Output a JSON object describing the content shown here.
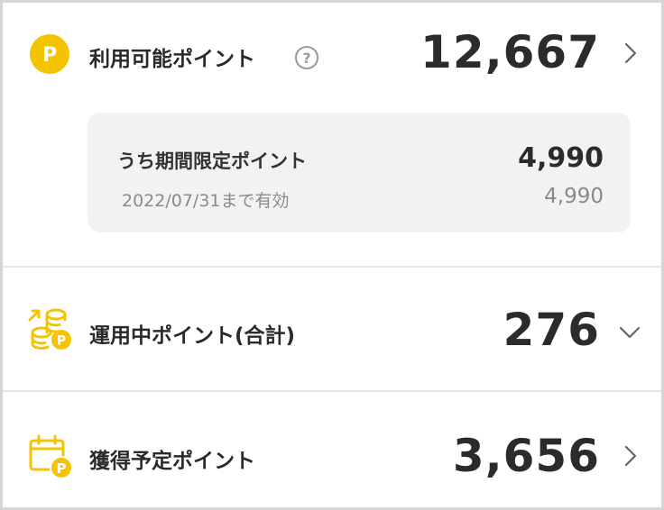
{
  "available": {
    "label": "利用可能ポイント",
    "value": "12,667",
    "icon": "p-coin-icon",
    "help_icon": "question-circle-icon",
    "chevron_icon": "chevron-right-icon"
  },
  "limited": {
    "label": "うち期間限定ポイント",
    "value": "4,990",
    "expiry_text": "2022/07/31まで有効",
    "expiry_value": "4,990"
  },
  "invested": {
    "label": "運用中ポイント(合計)",
    "value": "276",
    "icon": "coin-stack-icon",
    "chevron_icon": "chevron-down-icon"
  },
  "scheduled": {
    "label": "獲得予定ポイント",
    "value": "3,656",
    "icon": "calendar-p-icon",
    "chevron_icon": "chevron-right-icon"
  },
  "colors": {
    "accent": "#f5c400",
    "background": "#ffffff",
    "panel": "#f2f2f2",
    "divider": "#e6e6e6",
    "muted": "#8a8a8a"
  }
}
